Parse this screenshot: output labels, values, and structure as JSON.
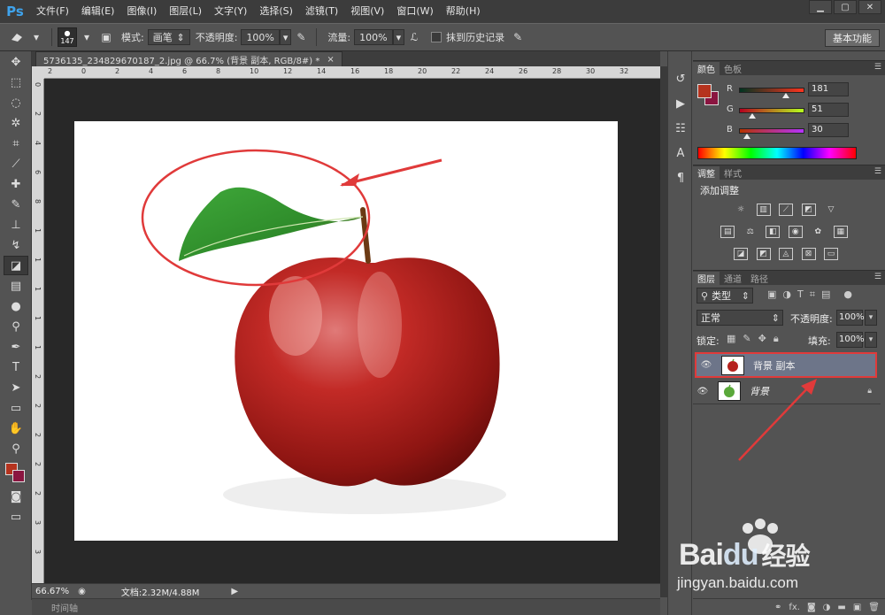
{
  "app": {
    "logo": "Ps",
    "minimize": "▁",
    "maximize": "▢",
    "close": "✕"
  },
  "menu": [
    "文件(F)",
    "编辑(E)",
    "图像(I)",
    "图层(L)",
    "文字(Y)",
    "选择(S)",
    "滤镜(T)",
    "视图(V)",
    "窗口(W)",
    "帮助(H)"
  ],
  "options": {
    "brush_size": "147",
    "mode_label": "模式:",
    "mode_value": "画笔",
    "opacity_label": "不透明度:",
    "opacity_value": "100%",
    "flow_label": "流量:",
    "flow_value": "100%",
    "erase_history_label": "抹到历史记录",
    "workspace_button": "基本功能"
  },
  "document": {
    "tab_title": "5736135_234829670187_2.jpg @ 66.7% (背景 副本, RGB/8#) *",
    "tab_close": "×",
    "zoom": "66.67%",
    "doc_info": "文档:2.32M/4.88M",
    "timeline": "时间轴"
  },
  "rulers": {
    "h_ticks": [
      "2",
      "0",
      "2",
      "4",
      "6",
      "8",
      "10",
      "12",
      "14",
      "16",
      "18",
      "20",
      "22",
      "24",
      "26",
      "28",
      "30",
      "32"
    ],
    "v_ticks": [
      "0",
      "2",
      "4",
      "6",
      "8",
      "1",
      "1",
      "1",
      "1",
      "1",
      "2",
      "2",
      "2",
      "2",
      "2",
      "3",
      "3"
    ]
  },
  "color_panel": {
    "tabs": [
      "颜色",
      "色板"
    ],
    "r_label": "R",
    "g_label": "G",
    "b_label": "B",
    "r_value": "181",
    "g_value": "51",
    "b_value": "30",
    "r": 181,
    "g": 51,
    "b": 30,
    "fg_color": "#b5331e",
    "bg_color": "#8a1540"
  },
  "adjust_panel": {
    "tabs": [
      "调整",
      "样式"
    ],
    "title": "添加调整"
  },
  "layers_panel": {
    "tabs": [
      "图层",
      "通道",
      "路径"
    ],
    "filter_label": "类型",
    "blend_mode": "正常",
    "opacity_label": "不透明度:",
    "opacity_value": "100%",
    "lock_label": "锁定:",
    "fill_label": "填充:",
    "fill_value": "100%",
    "layers": [
      {
        "name": "背景 副本",
        "selected": true
      },
      {
        "name": "背景",
        "selected": false
      }
    ],
    "footer_fx": "fx."
  },
  "watermark": {
    "brand": "Bai",
    "brand2": "du",
    "product": "经验",
    "url": "jingyan.baidu.com"
  },
  "colors": {
    "accent_red": "#e03a3a",
    "selected_layer": "#6d7589"
  }
}
